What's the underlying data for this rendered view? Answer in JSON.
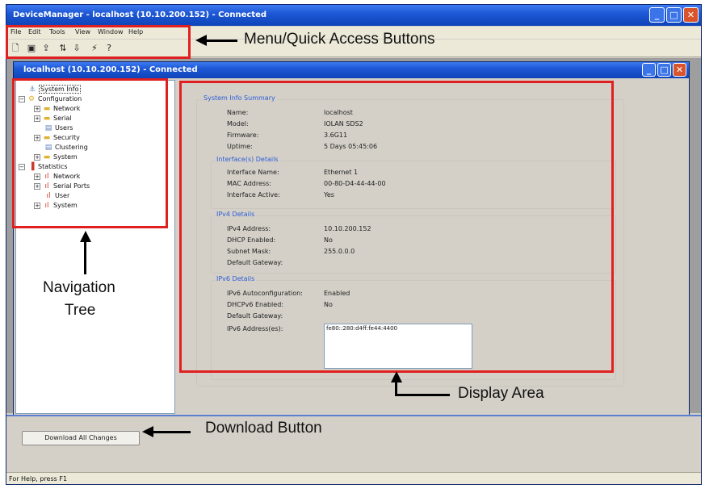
{
  "main_window": {
    "title": "DeviceManager - localhost (10.10.200.152) - Connected"
  },
  "menu": {
    "items": [
      "File",
      "Edit",
      "Tools",
      "View",
      "Window",
      "Help"
    ]
  },
  "toolbar": {
    "icons": [
      "new-icon",
      "save-icon",
      "upload-icon",
      "upload-download-icon",
      "connect-icon",
      "help-icon"
    ]
  },
  "child_window": {
    "title": "localhost (10.10.200.152) - Connected"
  },
  "tree": {
    "items": [
      {
        "label": "System Info"
      },
      {
        "label": "Configuration"
      },
      {
        "label": "Network"
      },
      {
        "label": "Serial"
      },
      {
        "label": "Users"
      },
      {
        "label": "Security"
      },
      {
        "label": "Clustering"
      },
      {
        "label": "System"
      },
      {
        "label": "Statistics"
      },
      {
        "label": "Network"
      },
      {
        "label": "Serial Ports"
      },
      {
        "label": "User"
      },
      {
        "label": "System"
      }
    ]
  },
  "display": {
    "summary_title": "System Info Summary",
    "fields": {
      "name_label": "Name:",
      "name_value": "localhost",
      "model_label": "Model:",
      "model_value": "IOLAN SDS2",
      "firmware_label": "Firmware:",
      "firmware_value": "3.6G11",
      "uptime_label": "Uptime:",
      "uptime_value": "5 Days 05:45:06"
    },
    "interface": {
      "title": "Interface(s) Details",
      "name_label": "Interface Name:",
      "name_value": "Ethernet 1",
      "mac_label": "MAC Address:",
      "mac_value": "00-80-D4-44-44-00",
      "active_label": "Interface Active:",
      "active_value": "Yes"
    },
    "ipv4": {
      "title": "IPv4 Details",
      "address_label": "IPv4 Address:",
      "address_value": "10.10.200.152",
      "dhcp_label": "DHCP Enabled:",
      "dhcp_value": "No",
      "mask_label": "Subnet Mask:",
      "mask_value": "255.0.0.0",
      "gateway_label": "Default Gateway:"
    },
    "ipv6": {
      "title": "IPv6 Details",
      "autoconf_label": "IPv6 Autoconfiguration:",
      "autoconf_value": "Enabled",
      "dhcpv6_label": "DHCPv6 Enabled:",
      "dhcpv6_value": "No",
      "gateway_label": "Default Gateway:",
      "addresses_label": "IPv6 Address(es):",
      "addresses_value": "fe80::280:d4ff:fe44:4400"
    }
  },
  "download_button_label": "Download All Changes",
  "status_text": "For Help, press F1",
  "annotations": {
    "menu_quick_access": "Menu/Quick Access Buttons",
    "navigation_line1": "Navigation",
    "navigation_line2": "Tree",
    "display_area": "Display Area",
    "download_button": "Download Button"
  },
  "colors": {
    "titlebar": "#1e58d6",
    "annotation_box": "#e02020",
    "group_title": "#2a5bd7"
  }
}
